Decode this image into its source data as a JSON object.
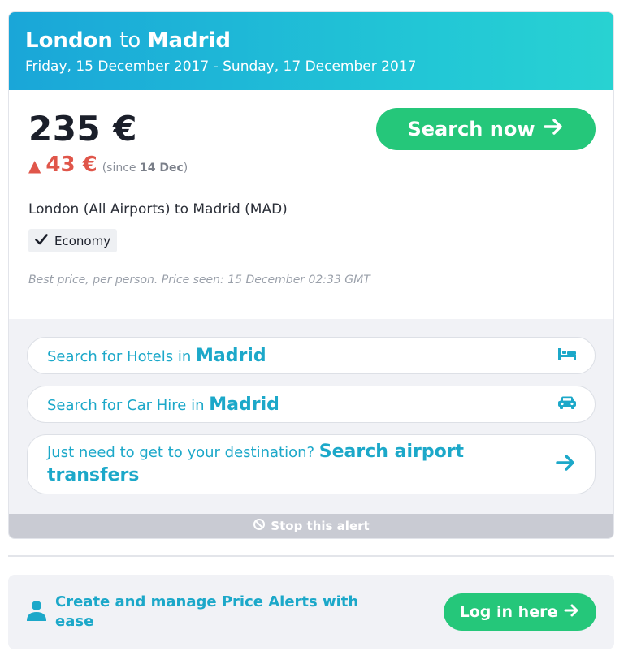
{
  "header": {
    "origin": "London",
    "connector": "to",
    "destination": "Madrid",
    "dates": "Friday, 15 December 2017 - Sunday, 17 December 2017"
  },
  "price": {
    "amount": "235 €",
    "change_symbol": "▲",
    "change_amount": "43 €",
    "since_prefix": "(since",
    "since_date": "14 Dec",
    "since_suffix": ")",
    "search_now_label": "Search now",
    "route_desc": "London (All Airports) to Madrid (MAD)",
    "cabin_class": "Economy",
    "fine_print": "Best price, per person. Price seen: 15 December 02:33 GMT"
  },
  "links": {
    "hotels_prefix": "Search for Hotels in",
    "hotels_city": "Madrid",
    "car_prefix": "Search for Car Hire in",
    "car_city": "Madrid",
    "transfer_prefix": "Just need to get to your destination?",
    "transfer_action": "Search airport transfers"
  },
  "stop_alert_label": "Stop this alert",
  "promo": {
    "message": "Create and manage Price Alerts with ease",
    "login_label": "Log in here"
  },
  "colors": {
    "header_start": "#1aa6d8",
    "header_end": "#28d2d2",
    "cta_green": "#25c77a",
    "link_blue": "#1ca8c9",
    "price_up_red": "#e0564a"
  },
  "icons": [
    "arrow-right-icon",
    "check-icon",
    "bed-icon",
    "car-icon",
    "ban-icon",
    "person-icon"
  ]
}
